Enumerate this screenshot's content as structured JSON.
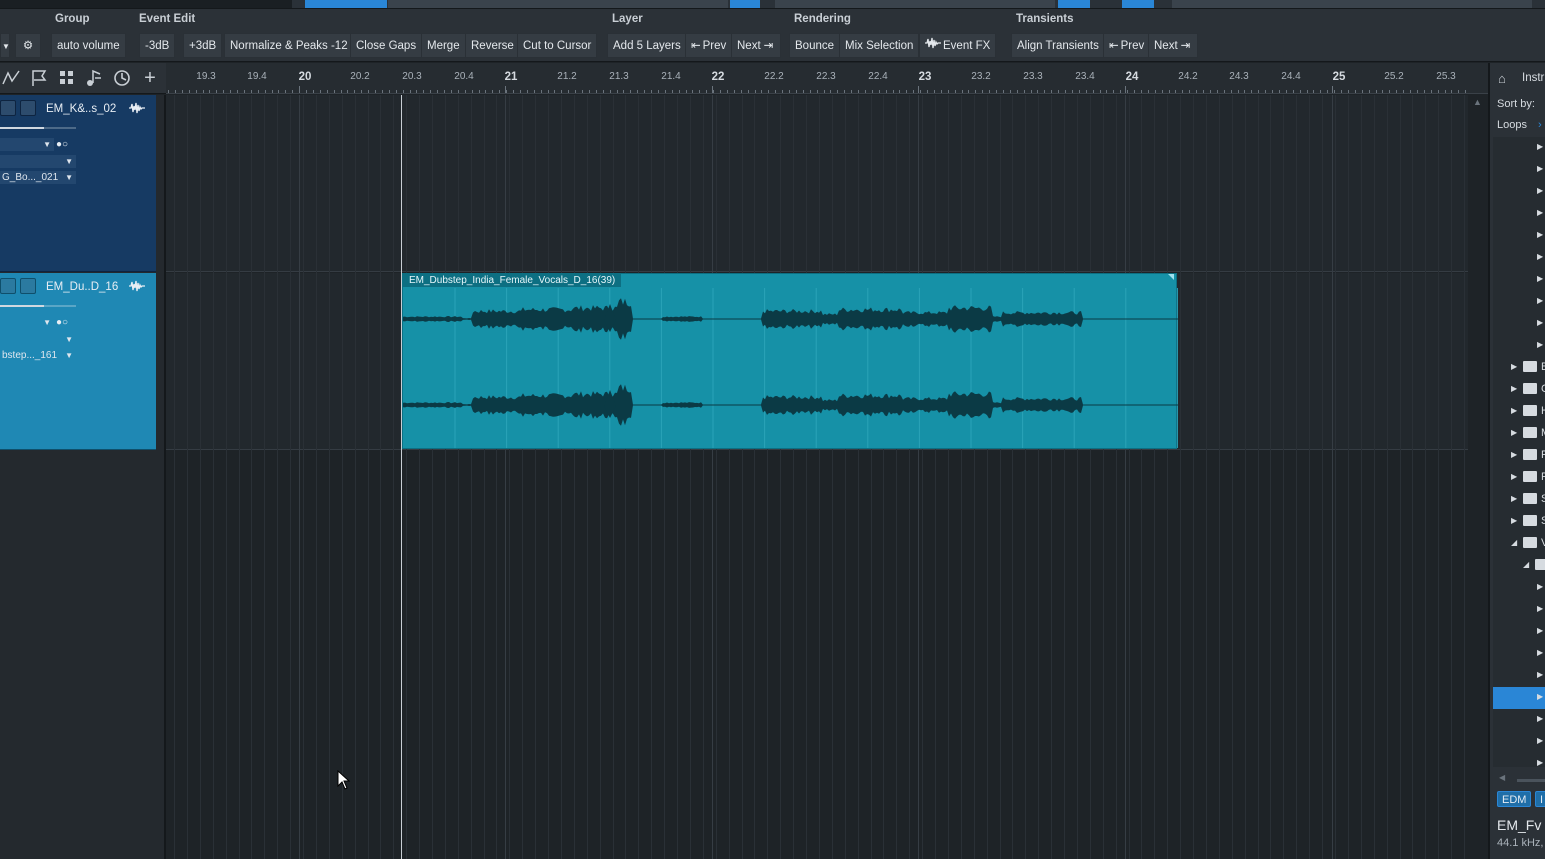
{
  "toolbar": {
    "groups": {
      "group": "Group",
      "event_edit": "Event Edit",
      "layer": "Layer",
      "rendering": "Rendering",
      "transients": "Transients"
    },
    "buttons": {
      "settings_icon": "⚙",
      "auto_volume": "auto volume",
      "minus_3db": "-3dB",
      "plus_3db": "+3dB",
      "normalize": "Normalize & Peaks -12",
      "close_gaps": "Close Gaps",
      "merge": "Merge",
      "reverse": "Reverse",
      "cut_to_cursor": "Cut to Cursor",
      "add_5_layers": "Add 5 Layers",
      "layer_prev": "Prev",
      "layer_next": "Next",
      "bounce": "Bounce",
      "mix_selection": "Mix Selection",
      "event_fx": "Event FX",
      "align_transients": "Align Transients",
      "transients_prev": "Prev",
      "transients_next": "Next"
    }
  },
  "ruler": {
    "labels": [
      "19.3",
      "19.4",
      "20",
      "20.2",
      "20.3",
      "20.4",
      "21",
      "21.2",
      "21.3",
      "21.4",
      "22",
      "22.2",
      "22.3",
      "22.4",
      "23",
      "23.2",
      "23.3",
      "23.4",
      "24",
      "24.2",
      "24.3",
      "24.4",
      "25",
      "25.2",
      "25.3"
    ]
  },
  "tracks": [
    {
      "name": "EM_K&..s_02",
      "file": "G_Bo..._021"
    },
    {
      "name": "EM_Du..D_16",
      "file": "bstep..._161"
    }
  ],
  "clip": {
    "title": "EM_Dubstep_India_Female_Vocals_D_16(39)"
  },
  "browser": {
    "tab": "Instr",
    "sort_by": "Sort by:",
    "loops": "Loops",
    "folder_letters": [
      "B",
      "C",
      "H",
      "M",
      "P",
      "R",
      "S",
      "S",
      "V"
    ],
    "tags": [
      "EDM",
      "I"
    ],
    "file_name": "EM_Fv",
    "file_info": "44.1 kHz,"
  },
  "colors": {
    "accent": "#2a86d6",
    "selected_track": "#1f88b4",
    "clip": "#1691a7",
    "track_blue": "#163a63"
  }
}
